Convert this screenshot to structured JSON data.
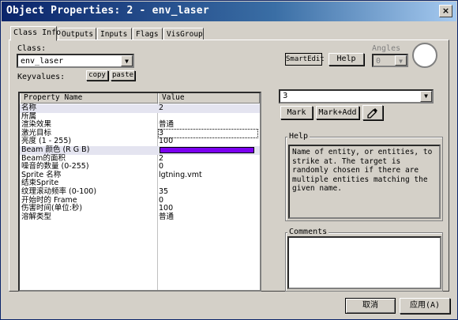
{
  "window": {
    "title": "Object Properties: 2 - env_laser",
    "close_label": "×"
  },
  "tabs": [
    {
      "label": "Class Info"
    },
    {
      "label": "Outputs"
    },
    {
      "label": "Inputs"
    },
    {
      "label": "Flags"
    },
    {
      "label": "VisGroup"
    }
  ],
  "class_section": {
    "class_label": "Class:",
    "class_value": "env_laser",
    "keyvalues_label": "Keyvalues:",
    "copy_label": "copy",
    "paste_label": "paste",
    "smartedit_label": "SmartEdit",
    "help_label": "Help",
    "angles_label": "Angles",
    "angles_value": "0"
  },
  "grid": {
    "col_name": "Property Name",
    "col_value": "Value",
    "rows": [
      {
        "key": "名称",
        "value": "2"
      },
      {
        "key": "所属",
        "value": ""
      },
      {
        "key": "渲染效果",
        "value": "普通"
      },
      {
        "key": "激光目标",
        "value": "3"
      },
      {
        "key": "亮度 (1 - 255)",
        "value": "100"
      },
      {
        "key": "Beam 颜色 (R G B)",
        "value": "",
        "color": "#7b00f0"
      },
      {
        "key": "Beam的面积",
        "value": "2"
      },
      {
        "key": "噪音的数量 (0-255)",
        "value": "0"
      },
      {
        "key": "Sprite 名称",
        "value": "lgtning.vmt"
      },
      {
        "key": "结束Sprite",
        "value": ""
      },
      {
        "key": "纹理滚动频率 (0-100)",
        "value": "35"
      },
      {
        "key": "开始时的 Frame",
        "value": "0"
      },
      {
        "key": "伤害时间(单位:秒)",
        "value": "100"
      },
      {
        "key": "溶解类型",
        "value": "普通"
      }
    ]
  },
  "value_editor": {
    "value": "3",
    "mark_label": "Mark",
    "markadd_label": "Mark+Add",
    "eyedropper_icon": "eyedropper-icon"
  },
  "help": {
    "title": "Help",
    "text": "Name of entity, or entities, to strike at. The target is randomly chosen if there are multiple entities matching the given name."
  },
  "comments": {
    "title": "Comments",
    "text": ""
  },
  "footer": {
    "cancel_label": "取消",
    "apply_label": "应用(A)"
  }
}
